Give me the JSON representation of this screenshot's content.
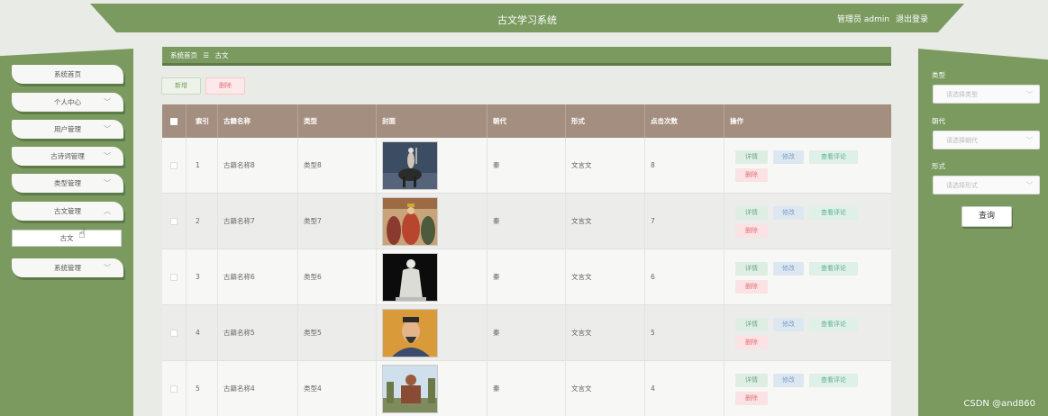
{
  "header": {
    "title": "古文学习系统",
    "role": "管理员 admin",
    "logout": "退出登录"
  },
  "sidebar": {
    "items": [
      {
        "label": "系统首页"
      },
      {
        "label": "个人中心"
      },
      {
        "label": "用户管理"
      },
      {
        "label": "古诗词管理"
      },
      {
        "label": "类型管理"
      },
      {
        "label": "古文管理"
      },
      {
        "label": "古文"
      },
      {
        "label": "系统管理"
      }
    ]
  },
  "breadcrumb": {
    "home": "系统首页",
    "separator": "☰",
    "current": "古文"
  },
  "toolbar": {
    "add_label": "新增",
    "delete_label": "删除"
  },
  "table": {
    "headers": {
      "index": "索引",
      "name": "古籍名称",
      "type": "类型",
      "cover": "封面",
      "dynasty": "朝代",
      "form": "形式",
      "clicks": "点击次数",
      "actions": "操作"
    },
    "rows": [
      {
        "index": "1",
        "name": "古籍名称8",
        "type": "类型8",
        "cover": "warrior-statue",
        "dynasty": "秦",
        "form": "文言文",
        "clicks": "8"
      },
      {
        "index": "2",
        "name": "古籍名称7",
        "type": "类型7",
        "cover": "emperor-painting",
        "dynasty": "秦",
        "form": "文言文",
        "clicks": "7"
      },
      {
        "index": "3",
        "name": "古籍名称6",
        "type": "类型6",
        "cover": "white-sage-statue",
        "dynasty": "秦",
        "form": "文言文",
        "clicks": "6"
      },
      {
        "index": "4",
        "name": "古籍名称5",
        "type": "类型5",
        "cover": "sage-portrait",
        "dynasty": "秦",
        "form": "文言文",
        "clicks": "5"
      },
      {
        "index": "5",
        "name": "古籍名称4",
        "type": "类型4",
        "cover": "temple-statue",
        "dynasty": "秦",
        "form": "文言文",
        "clicks": "4"
      }
    ],
    "actions": {
      "detail": "详情",
      "edit": "修改",
      "comment": "查看评论",
      "remove": "删除"
    }
  },
  "search": {
    "type_label": "类型",
    "type_placeholder": "请选择类型",
    "dynasty_label": "朝代",
    "dynasty_placeholder": "请选择朝代",
    "form_label": "形式",
    "form_placeholder": "请选择形式",
    "button": "查询"
  },
  "watermark": "CSDN @and860",
  "colors": {
    "accent": "#7a9a5f",
    "table_header": "#a48e80",
    "danger": "#e2727c"
  }
}
